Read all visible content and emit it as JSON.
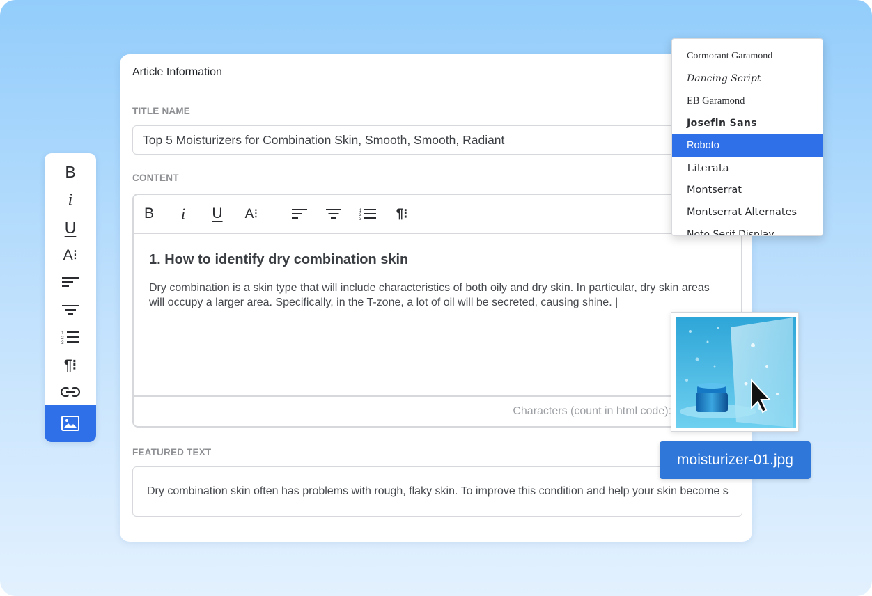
{
  "card": {
    "title": "Article Information",
    "title_name_label": "TITLE NAME",
    "title_value": "Top 5 Moisturizers for Combination Skin, Smooth, Smooth, Radiant",
    "content_label": "CONTENT",
    "featured_label": "FEATURED TEXT",
    "featured_value": "Dry combination skin often has problems with rough, flaky skin. To improve this condition and help your skin become s"
  },
  "editor": {
    "toolbar": {
      "bold": "B",
      "italic": "i",
      "underline": "U",
      "font_size": "A⁝",
      "paragraph": "¶⁝"
    },
    "heading": "1. How to identify dry combination skin",
    "paragraph": "Dry combination is a skin type that will include characteristics of both oily and dry skin. In particular, dry skin areas will occupy a larger area. Specifically, in the T-zone, a lot of oil will be secreted, causing shine. |",
    "footer": "Characters (count in html code):"
  },
  "side_toolbar": {
    "bold": "B",
    "italic": "i",
    "underline": "U",
    "font_size": "A⁝",
    "paragraph": "¶⁝",
    "active_item": "image"
  },
  "font_dropdown": {
    "selected": "Roboto",
    "items": [
      "Cormorant Garamond",
      "Dancing Script",
      "EB Garamond",
      "Josefin Sans",
      "Roboto",
      "Literata",
      "Montserrat",
      "Montserrat Alternates",
      "Noto Serif Display"
    ]
  },
  "image": {
    "filename": "moisturizer-01.jpg"
  },
  "colors": {
    "accent": "#2f6fe8",
    "file_tag": "#2f77d8",
    "background_top": "#93cdfb",
    "background_bottom": "#e3f1fe"
  }
}
